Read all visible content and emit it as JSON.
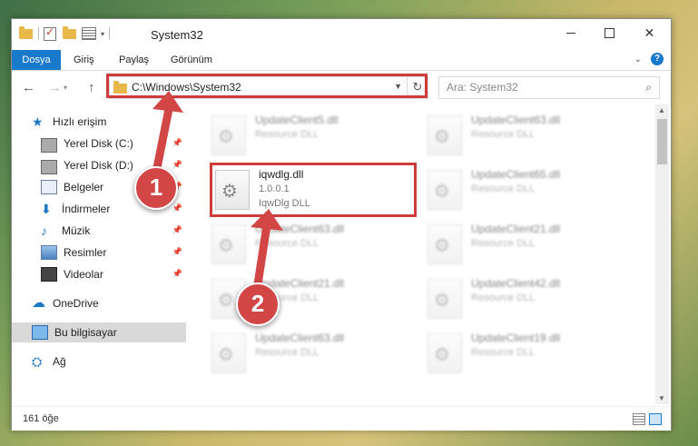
{
  "titlebar": {
    "title": "System32",
    "minimize_label": "",
    "maximize_label": "",
    "close_label": "✕"
  },
  "ribbon": {
    "tabs": [
      "Dosya",
      "Giriş",
      "Paylaş",
      "Görünüm"
    ],
    "help_label": "?"
  },
  "nav": {
    "address": "C:\\Windows\\System32",
    "search_placeholder": "Ara: System32"
  },
  "sidebar": {
    "items": [
      {
        "label": "Hızlı erişim",
        "icon": "star-icon"
      },
      {
        "label": "Yerel Disk (C:)",
        "icon": "disk-icon",
        "pinned": true
      },
      {
        "label": "Yerel Disk (D:)",
        "icon": "disk-icon",
        "pinned": true
      },
      {
        "label": "Belgeler",
        "icon": "document-icon",
        "pinned": true
      },
      {
        "label": "İndirmeler",
        "icon": "download-icon",
        "pinned": true
      },
      {
        "label": "Müzik",
        "icon": "music-icon",
        "pinned": true
      },
      {
        "label": "Resimler",
        "icon": "pictures-icon",
        "pinned": true
      },
      {
        "label": "Videolar",
        "icon": "video-icon",
        "pinned": true
      },
      {
        "label": "OneDrive",
        "icon": "cloud-icon"
      },
      {
        "label": "Bu bilgisayar",
        "icon": "computer-icon",
        "selected": true
      },
      {
        "label": "Ağ",
        "icon": "network-icon"
      }
    ]
  },
  "files": [
    {
      "name": "UpdateClient5.dll",
      "desc": "Resource DLL",
      "blurred": true
    },
    {
      "name": "UpdateClient63.dll",
      "desc": "Resource DLL",
      "blurred": true
    },
    {
      "name": "iqwdlg.dll",
      "version": "1.0.0.1",
      "desc": "IqwDlg DLL",
      "blurred": false
    },
    {
      "name": "UpdateClient65.dll",
      "desc": "Resource DLL",
      "blurred": true
    },
    {
      "name": "UpdateClient63.dll",
      "desc": "Resource DLL",
      "blurred": true
    },
    {
      "name": "UpdateClient21.dll",
      "desc": "Resource DLL",
      "blurred": true
    },
    {
      "name": "UpdateClient21.dll",
      "desc": "Resource DLL",
      "blurred": true
    },
    {
      "name": "UpdateClient42.dll",
      "desc": "Resource DLL",
      "blurred": true
    },
    {
      "name": "UpdateClient63.dll",
      "desc": "Resource DLL",
      "blurred": true
    },
    {
      "name": "UpdateClient19.dll",
      "desc": "Resource DLL",
      "blurred": true
    }
  ],
  "status": {
    "item_count": "161 öğe"
  },
  "annotations": {
    "callout_1": "1",
    "callout_2": "2",
    "highlight_color": "#cf3b3b"
  },
  "colors": {
    "accent": "#1979ca",
    "callout": "#d24646"
  }
}
